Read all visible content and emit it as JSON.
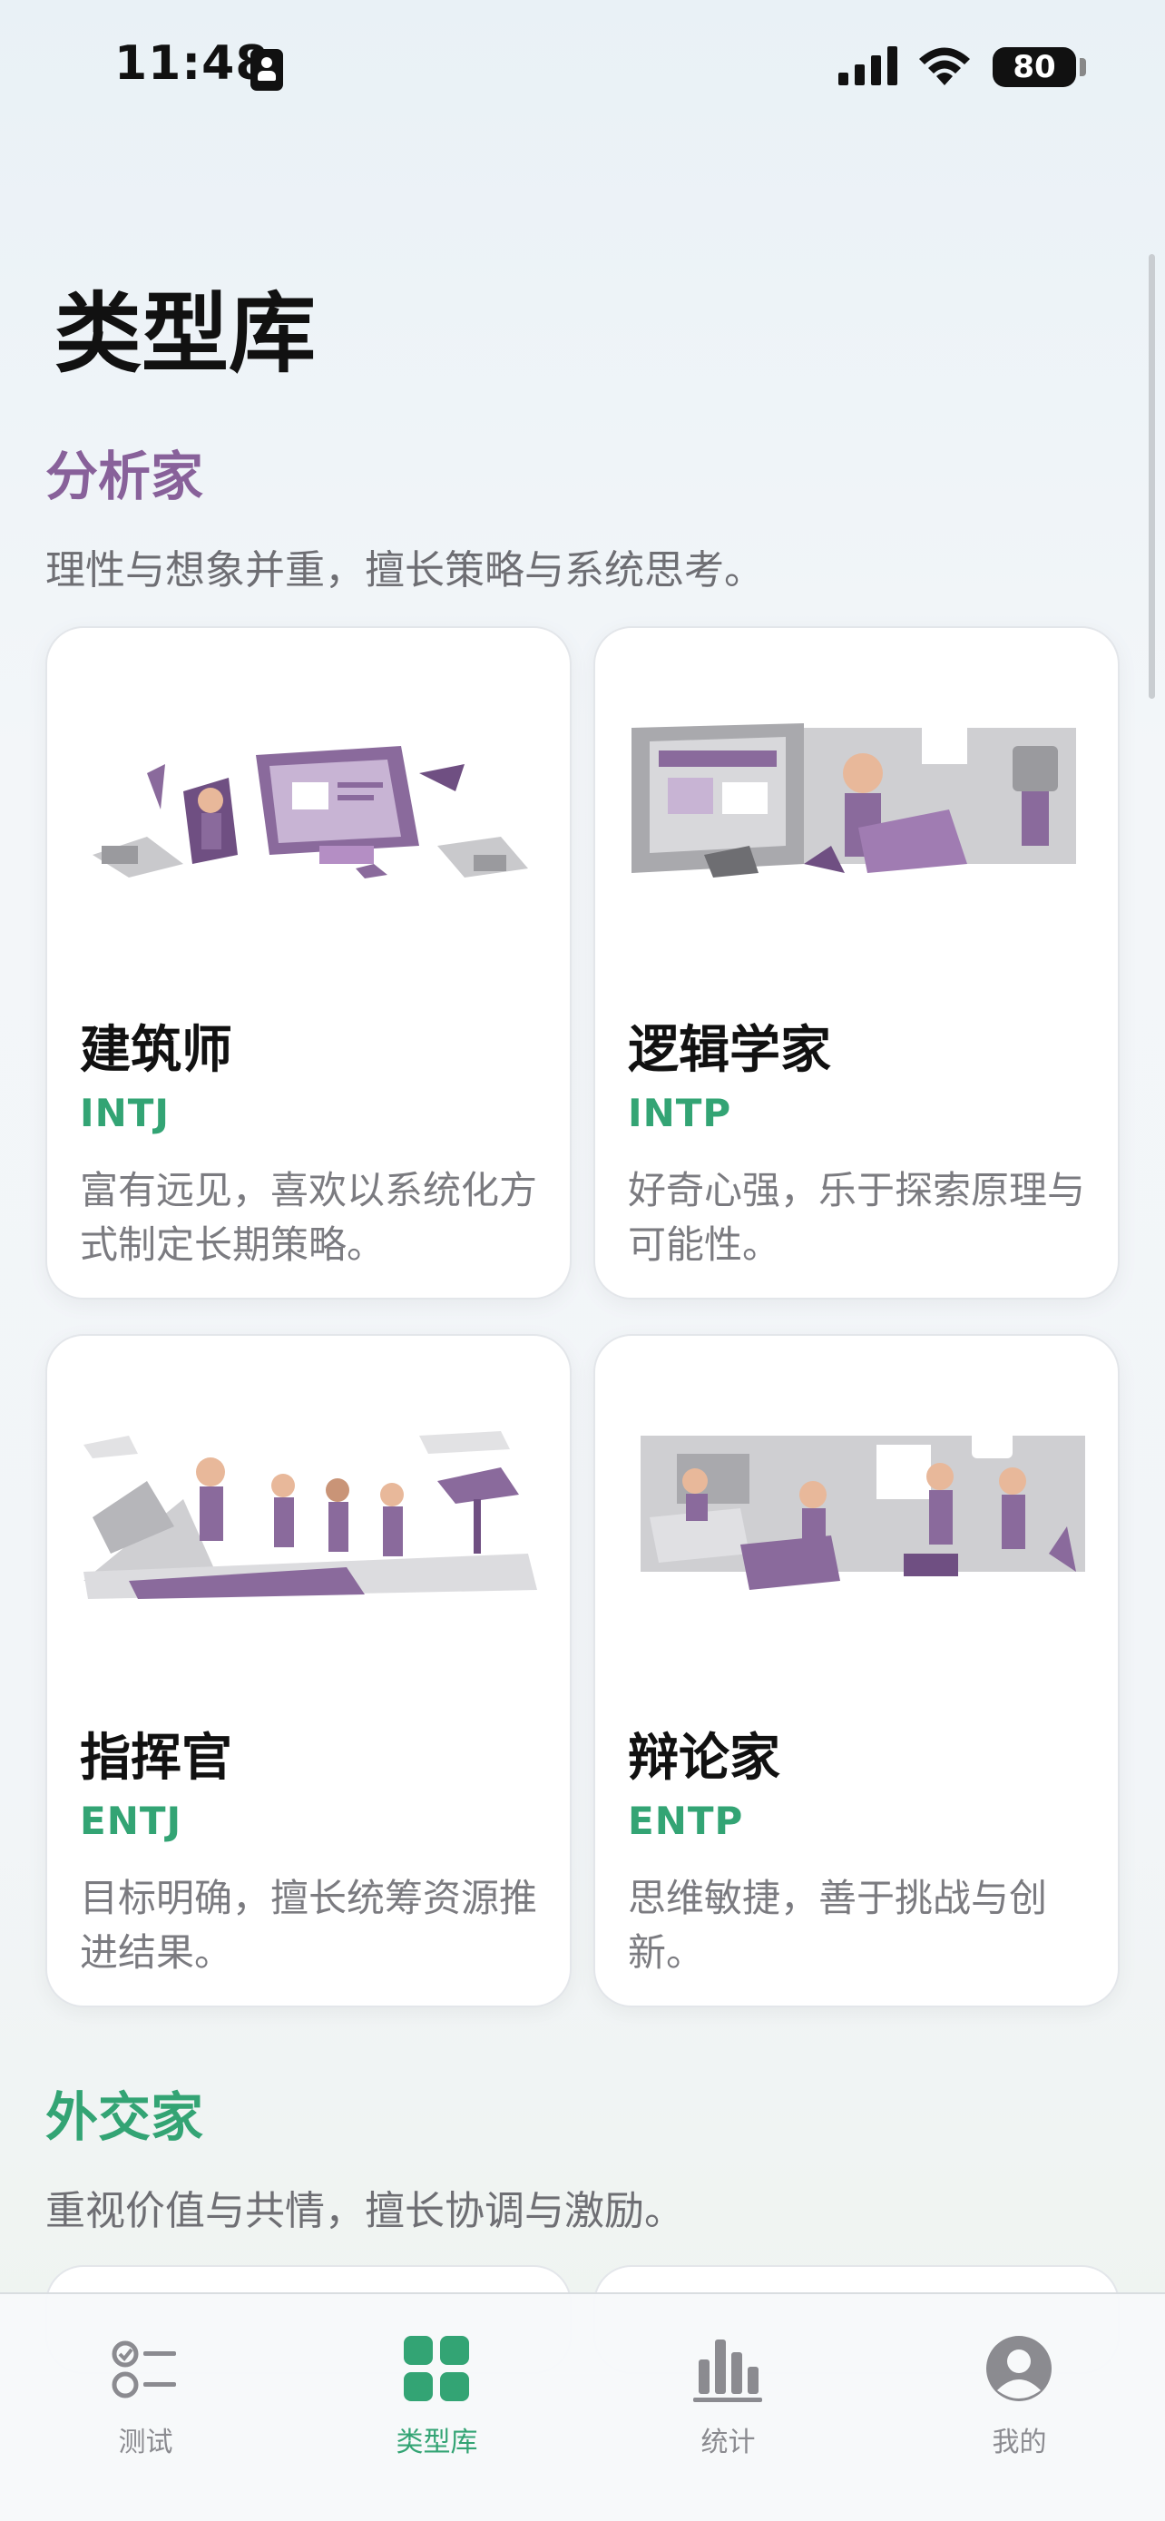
{
  "status_bar": {
    "time": "11:48",
    "battery": "80"
  },
  "page": {
    "title": "类型库"
  },
  "sections": [
    {
      "title": "分析家",
      "color": "#88619a",
      "description": "理性与想象并重，擅长策略与系统思考。",
      "cards": [
        {
          "name": "建筑师",
          "code": "INTJ",
          "desc": "富有远见，喜欢以系统化方式制定长期策略。"
        },
        {
          "name": "逻辑学家",
          "code": "INTP",
          "desc": "好奇心强，乐于探索原理与可能性。"
        },
        {
          "name": "指挥官",
          "code": "ENTJ",
          "desc": "目标明确，擅长统筹资源推进结果。"
        },
        {
          "name": "辩论家",
          "code": "ENTP",
          "desc": "思维敏捷，善于挑战与创新。"
        }
      ]
    },
    {
      "title": "外交家",
      "color": "#33a474",
      "description": "重视价值与共情，擅长协调与激励。"
    }
  ],
  "tabs": [
    {
      "label": "测试",
      "icon": "checklist-icon",
      "active": false
    },
    {
      "label": "类型库",
      "icon": "grid-icon",
      "active": true
    },
    {
      "label": "统计",
      "icon": "bar-chart-icon",
      "active": false
    },
    {
      "label": "我的",
      "icon": "profile-icon",
      "active": false
    }
  ],
  "colors": {
    "accent": "#33a474",
    "analyst": "#88619a",
    "muted": "#7b7b80"
  }
}
